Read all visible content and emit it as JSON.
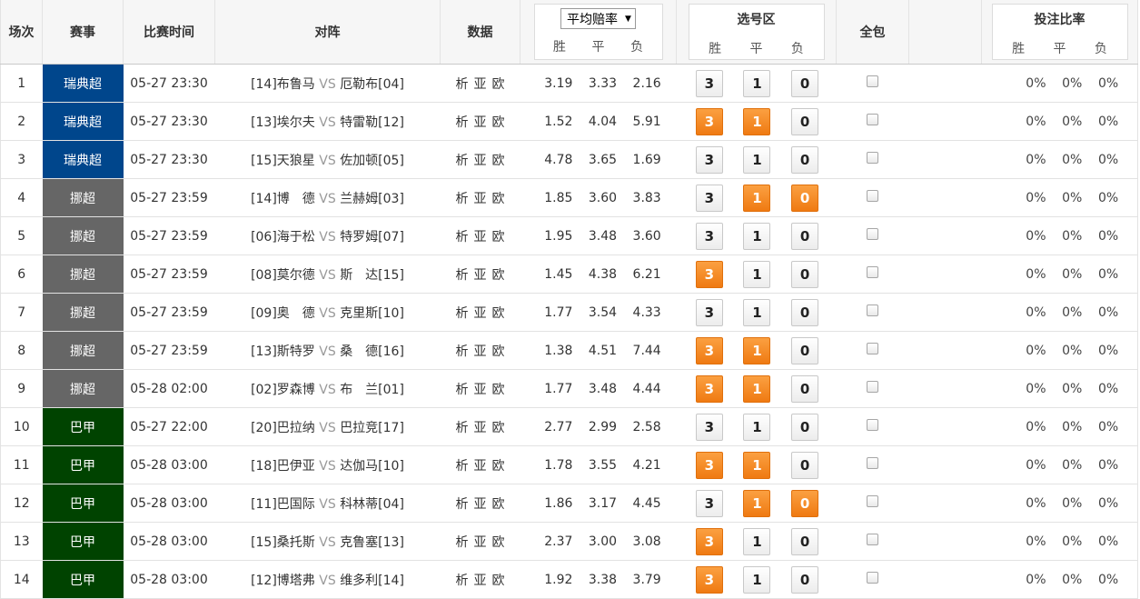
{
  "headers": {
    "num": "场次",
    "league": "赛事",
    "time": "比赛时间",
    "match": "对阵",
    "data": "数据",
    "odds_select": "平均赔率",
    "win": "胜",
    "draw": "平",
    "lose": "负",
    "picks": "选号区",
    "all": "全包",
    "bet_ratio": "投注比率"
  },
  "colors": {
    "瑞典超": "#00468c",
    "挪超": "#666666",
    "巴甲": "#004300",
    "selected_button": "#f58a22"
  },
  "vs_text": "VS",
  "data_links": [
    "析",
    "亚",
    "欧"
  ],
  "rows": [
    {
      "num": "1",
      "league": "瑞典超",
      "time": "05-27 23:30",
      "home": "[14]布鲁马",
      "away": "厄勒布[04]",
      "odds": [
        "3.19",
        "3.33",
        "2.16"
      ],
      "picks": [
        "3",
        "1",
        "0"
      ],
      "selected": [
        false,
        false,
        false
      ],
      "ratios": [
        "0%",
        "0%",
        "0%"
      ]
    },
    {
      "num": "2",
      "league": "瑞典超",
      "time": "05-27 23:30",
      "home": "[13]埃尔夫",
      "away": "特雷勒[12]",
      "odds": [
        "1.52",
        "4.04",
        "5.91"
      ],
      "picks": [
        "3",
        "1",
        "0"
      ],
      "selected": [
        true,
        true,
        false
      ],
      "ratios": [
        "0%",
        "0%",
        "0%"
      ]
    },
    {
      "num": "3",
      "league": "瑞典超",
      "time": "05-27 23:30",
      "home": "[15]天狼星",
      "away": "佐加顿[05]",
      "odds": [
        "4.78",
        "3.65",
        "1.69"
      ],
      "picks": [
        "3",
        "1",
        "0"
      ],
      "selected": [
        false,
        false,
        false
      ],
      "ratios": [
        "0%",
        "0%",
        "0%"
      ]
    },
    {
      "num": "4",
      "league": "挪超",
      "time": "05-27 23:59",
      "home": "[14]博　德",
      "away": "兰赫姆[03]",
      "odds": [
        "1.85",
        "3.60",
        "3.83"
      ],
      "picks": [
        "3",
        "1",
        "0"
      ],
      "selected": [
        false,
        true,
        true
      ],
      "ratios": [
        "0%",
        "0%",
        "0%"
      ]
    },
    {
      "num": "5",
      "league": "挪超",
      "time": "05-27 23:59",
      "home": "[06]海于松",
      "away": "特罗姆[07]",
      "odds": [
        "1.95",
        "3.48",
        "3.60"
      ],
      "picks": [
        "3",
        "1",
        "0"
      ],
      "selected": [
        false,
        false,
        false
      ],
      "ratios": [
        "0%",
        "0%",
        "0%"
      ]
    },
    {
      "num": "6",
      "league": "挪超",
      "time": "05-27 23:59",
      "home": "[08]莫尔德",
      "away": "斯　达[15]",
      "odds": [
        "1.45",
        "4.38",
        "6.21"
      ],
      "picks": [
        "3",
        "1",
        "0"
      ],
      "selected": [
        true,
        false,
        false
      ],
      "ratios": [
        "0%",
        "0%",
        "0%"
      ]
    },
    {
      "num": "7",
      "league": "挪超",
      "time": "05-27 23:59",
      "home": "[09]奥　德",
      "away": "克里斯[10]",
      "odds": [
        "1.77",
        "3.54",
        "4.33"
      ],
      "picks": [
        "3",
        "1",
        "0"
      ],
      "selected": [
        false,
        false,
        false
      ],
      "ratios": [
        "0%",
        "0%",
        "0%"
      ]
    },
    {
      "num": "8",
      "league": "挪超",
      "time": "05-27 23:59",
      "home": "[13]斯特罗",
      "away": "桑　德[16]",
      "odds": [
        "1.38",
        "4.51",
        "7.44"
      ],
      "picks": [
        "3",
        "1",
        "0"
      ],
      "selected": [
        true,
        true,
        false
      ],
      "ratios": [
        "0%",
        "0%",
        "0%"
      ]
    },
    {
      "num": "9",
      "league": "挪超",
      "time": "05-28 02:00",
      "home": "[02]罗森博",
      "away": "布　兰[01]",
      "odds": [
        "1.77",
        "3.48",
        "4.44"
      ],
      "picks": [
        "3",
        "1",
        "0"
      ],
      "selected": [
        true,
        true,
        false
      ],
      "ratios": [
        "0%",
        "0%",
        "0%"
      ]
    },
    {
      "num": "10",
      "league": "巴甲",
      "time": "05-27 22:00",
      "home": "[20]巴拉纳",
      "away": "巴拉竞[17]",
      "odds": [
        "2.77",
        "2.99",
        "2.58"
      ],
      "picks": [
        "3",
        "1",
        "0"
      ],
      "selected": [
        false,
        false,
        false
      ],
      "ratios": [
        "0%",
        "0%",
        "0%"
      ]
    },
    {
      "num": "11",
      "league": "巴甲",
      "time": "05-28 03:00",
      "home": "[18]巴伊亚",
      "away": "达伽马[10]",
      "odds": [
        "1.78",
        "3.55",
        "4.21"
      ],
      "picks": [
        "3",
        "1",
        "0"
      ],
      "selected": [
        true,
        true,
        false
      ],
      "ratios": [
        "0%",
        "0%",
        "0%"
      ]
    },
    {
      "num": "12",
      "league": "巴甲",
      "time": "05-28 03:00",
      "home": "[11]巴国际",
      "away": "科林蒂[04]",
      "odds": [
        "1.86",
        "3.17",
        "4.45"
      ],
      "picks": [
        "3",
        "1",
        "0"
      ],
      "selected": [
        false,
        true,
        true
      ],
      "ratios": [
        "0%",
        "0%",
        "0%"
      ]
    },
    {
      "num": "13",
      "league": "巴甲",
      "time": "05-28 03:00",
      "home": "[15]桑托斯",
      "away": "克鲁塞[13]",
      "odds": [
        "2.37",
        "3.00",
        "3.08"
      ],
      "picks": [
        "3",
        "1",
        "0"
      ],
      "selected": [
        true,
        false,
        false
      ],
      "ratios": [
        "0%",
        "0%",
        "0%"
      ]
    },
    {
      "num": "14",
      "league": "巴甲",
      "time": "05-28 03:00",
      "home": "[12]博塔弗",
      "away": "维多利[14]",
      "odds": [
        "1.92",
        "3.38",
        "3.79"
      ],
      "picks": [
        "3",
        "1",
        "0"
      ],
      "selected": [
        true,
        false,
        false
      ],
      "ratios": [
        "0%",
        "0%",
        "0%"
      ]
    }
  ]
}
